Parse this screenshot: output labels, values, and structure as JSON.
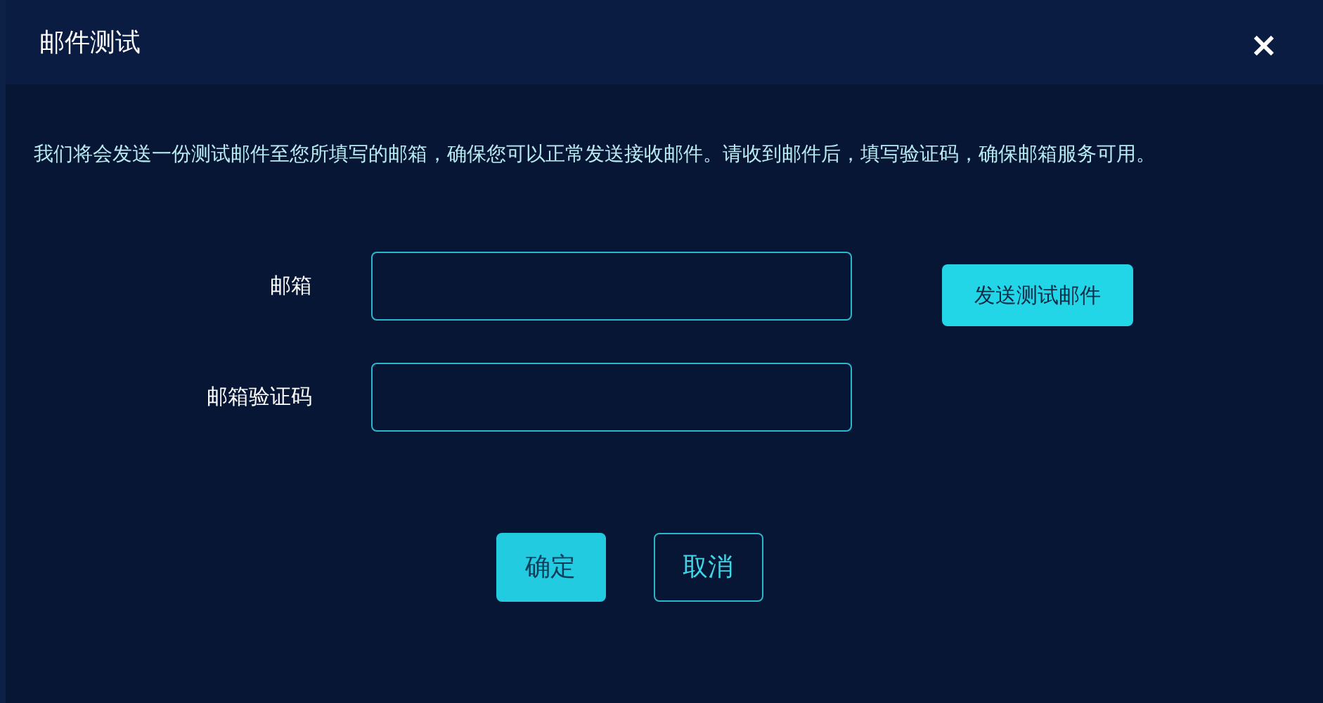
{
  "dialog": {
    "title": "邮件测试",
    "close": "×",
    "description": "我们将会发送一份测试邮件至您所填写的邮箱，确保您可以正常发送接收邮件。请收到邮件后，填写验证码，确保邮箱服务可用。",
    "fields": [
      {
        "label": "邮箱",
        "button": "发送测试邮件"
      },
      {
        "label": "邮箱验证码"
      }
    ],
    "buttons": [
      {
        "label": "确定",
        "kind": "primary"
      },
      {
        "label": "取消",
        "kind": "secondary"
      }
    ]
  }
}
